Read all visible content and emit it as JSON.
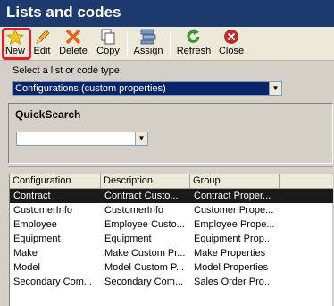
{
  "window": {
    "title": "Lists and codes"
  },
  "toolbar": {
    "new": "New",
    "edit": "Edit",
    "delete": "Delete",
    "copy": "Copy",
    "assign": "Assign",
    "refresh": "Refresh",
    "close": "Close"
  },
  "selector": {
    "label": "Select a list or code type:",
    "value": "Configurations (custom properties)"
  },
  "quicksearch": {
    "title": "QuickSearch",
    "value": ""
  },
  "grid": {
    "columns": [
      "Configuration",
      "Description",
      "Group"
    ],
    "rows": [
      [
        "Contract",
        "Contract Custo...",
        "Contract Proper..."
      ],
      [
        "CustomerInfo",
        "CustomerInfo",
        "Customer Prope..."
      ],
      [
        "Employee",
        "Employee Custo...",
        "Employee Prope..."
      ],
      [
        "Equipment",
        "Equipment",
        "Equipment Prop..."
      ],
      [
        "Make",
        "Make Custom Pr...",
        "Make Properties"
      ],
      [
        "Model",
        "Model Custom P...",
        "Model Properties"
      ],
      [
        "Secondary Com...",
        "Secondary Com...",
        "Sales Order Pro..."
      ]
    ],
    "selected_row": 0
  },
  "colors": {
    "title_bg": "#1c3a6e",
    "highlight": "#e0202a",
    "selected_row": "#1a1a1a"
  }
}
